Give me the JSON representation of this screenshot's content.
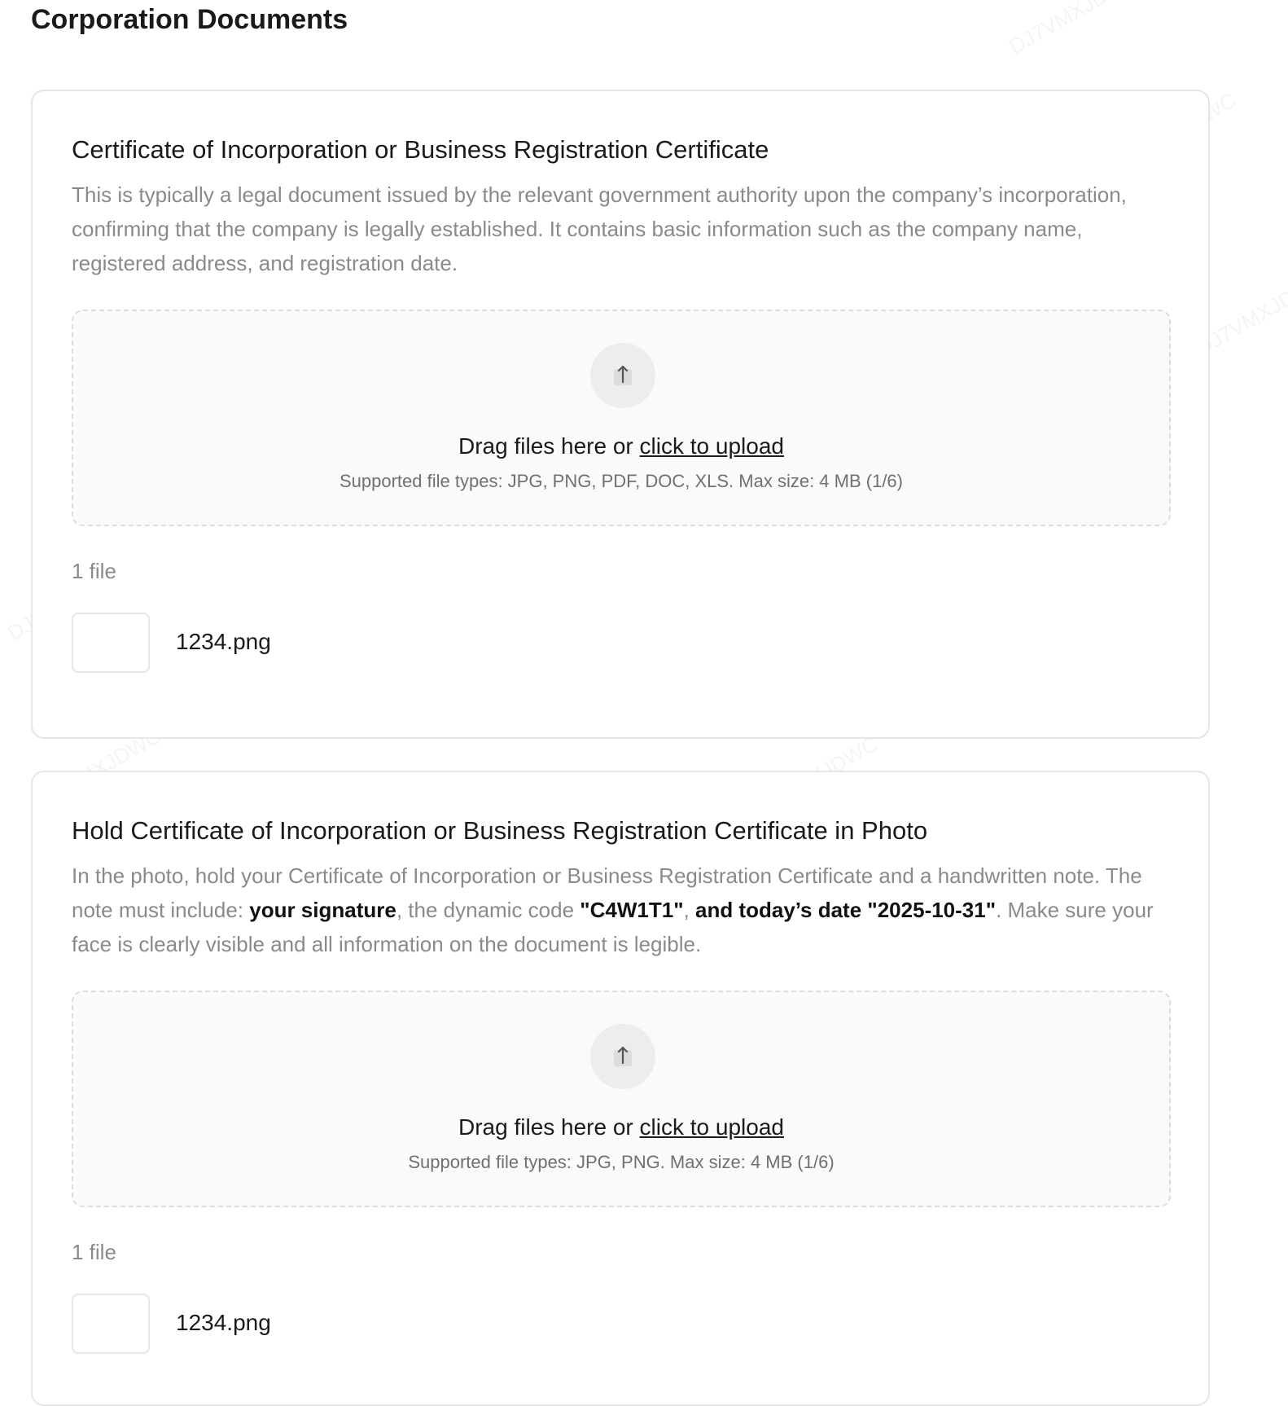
{
  "page": {
    "title": "Corporation Documents"
  },
  "watermark_text": "DJ7VMXJDWC",
  "cards": [
    {
      "title": "Certificate of Incorporation or Business Registration Certificate",
      "description": "This is typically a legal document issued by the relevant government authority upon the company’s incorporation, confirming that the company is legally established. It contains basic information such as the company name, registered address, and registration date.",
      "upload": {
        "icon": "upload-arrow-icon",
        "prompt_text": "Drag files here or ",
        "link_text": "click to upload",
        "hint": "Supported file types: JPG, PNG, PDF, DOC, XLS. Max size: 4 MB (1/6)"
      },
      "file_count": "1 file",
      "files": [
        {
          "name": "1234.png"
        }
      ]
    },
    {
      "title": "Hold Certificate of Incorporation or Business Registration Certificate in Photo",
      "description_parts": {
        "p1": "In the photo, hold your Certificate of Incorporation or Business Registration Certificate and a handwritten note. The note must include: ",
        "b1": "your signature",
        "p2": ", the dynamic code ",
        "b2": "\"C4W1T1\"",
        "p3": ", ",
        "b3": "and today’s date \"2025-10-31\"",
        "p4": ". Make sure your face is clearly visible and all information on the document is legible."
      },
      "upload": {
        "icon": "upload-arrow-icon",
        "prompt_text": "Drag files here or ",
        "link_text": "click to upload",
        "hint": "Supported file types: JPG, PNG. Max size: 4 MB (1/6)"
      },
      "file_count": "1 file",
      "files": [
        {
          "name": "1234.png"
        }
      ]
    }
  ]
}
